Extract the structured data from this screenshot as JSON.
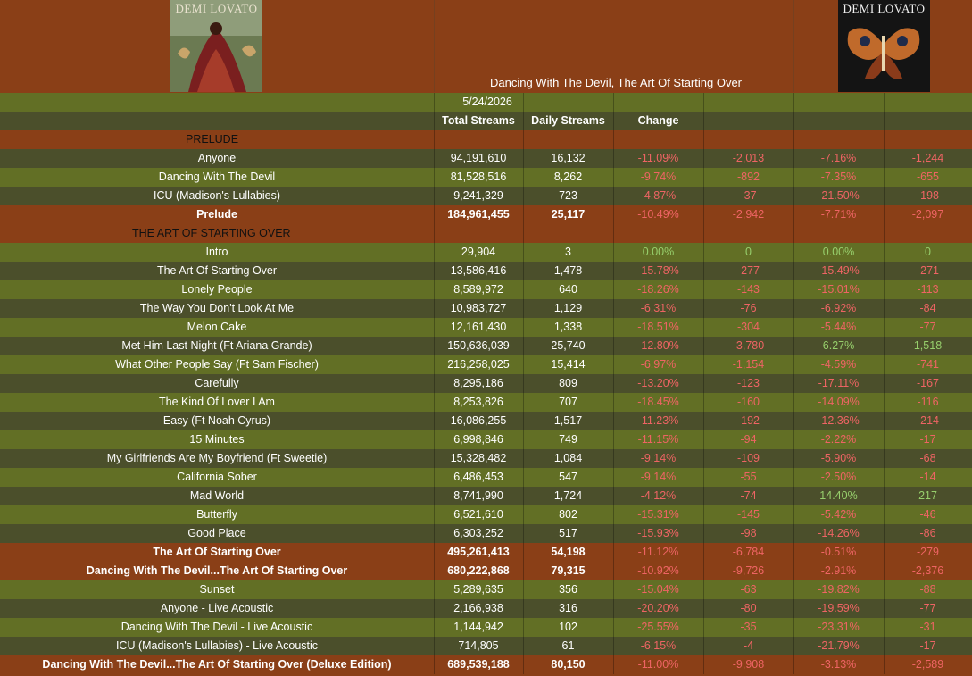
{
  "header": {
    "title": "Dancing With The Devil, The Art Of Starting Over",
    "cover_left_text": "DEMI LOVATO",
    "cover_right_text": "DEMI LOVATO"
  },
  "date": "5/24/2026",
  "columns": {
    "total": "Total Streams",
    "daily": "Daily Streams",
    "change": "Change"
  },
  "colors": {
    "brown": "#8a3f17",
    "olive": "#626f25",
    "dark_olive": "#4b4f2b",
    "negative": "#ee6464",
    "positive": "#97cf6c"
  },
  "sections": [
    {
      "label": "PRELUDE",
      "rows": [
        {
          "name": "Anyone",
          "total": "94,191,610",
          "daily": "16,132",
          "chg": "-11.09%",
          "d1": "-2,013",
          "p2": "-7.16%",
          "d2": "-1,244"
        },
        {
          "name": "Dancing With The Devil",
          "total": "81,528,516",
          "daily": "8,262",
          "chg": "-9.74%",
          "d1": "-892",
          "p2": "-7.35%",
          "d2": "-655"
        },
        {
          "name": "ICU (Madison's Lullabies)",
          "total": "9,241,329",
          "daily": "723",
          "chg": "-4.87%",
          "d1": "-37",
          "p2": "-21.50%",
          "d2": "-198"
        }
      ],
      "totals": [
        {
          "name": "Prelude",
          "total": "184,961,455",
          "daily": "25,117",
          "chg": "-10.49%",
          "d1": "-2,942",
          "p2": "-7.71%",
          "d2": "-2,097"
        }
      ]
    },
    {
      "label": "THE ART OF STARTING OVER",
      "rows": [
        {
          "name": "Intro",
          "total": "29,904",
          "daily": "3",
          "chg": "0.00%",
          "d1": "0",
          "p2": "0.00%",
          "d2": "0"
        },
        {
          "name": "The Art Of Starting Over",
          "total": "13,586,416",
          "daily": "1,478",
          "chg": "-15.78%",
          "d1": "-277",
          "p2": "-15.49%",
          "d2": "-271"
        },
        {
          "name": "Lonely People",
          "total": "8,589,972",
          "daily": "640",
          "chg": "-18.26%",
          "d1": "-143",
          "p2": "-15.01%",
          "d2": "-113"
        },
        {
          "name": "The Way You Don't Look At Me",
          "total": "10,983,727",
          "daily": "1,129",
          "chg": "-6.31%",
          "d1": "-76",
          "p2": "-6.92%",
          "d2": "-84"
        },
        {
          "name": "Melon Cake",
          "total": "12,161,430",
          "daily": "1,338",
          "chg": "-18.51%",
          "d1": "-304",
          "p2": "-5.44%",
          "d2": "-77"
        },
        {
          "name": "Met Him Last Night (Ft Ariana Grande)",
          "total": "150,636,039",
          "daily": "25,740",
          "chg": "-12.80%",
          "d1": "-3,780",
          "p2": "6.27%",
          "d2": "1,518"
        },
        {
          "name": "What Other People Say (Ft Sam Fischer)",
          "total": "216,258,025",
          "daily": "15,414",
          "chg": "-6.97%",
          "d1": "-1,154",
          "p2": "-4.59%",
          "d2": "-741"
        },
        {
          "name": "Carefully",
          "total": "8,295,186",
          "daily": "809",
          "chg": "-13.20%",
          "d1": "-123",
          "p2": "-17.11%",
          "d2": "-167"
        },
        {
          "name": "The Kind Of Lover I Am",
          "total": "8,253,826",
          "daily": "707",
          "chg": "-18.45%",
          "d1": "-160",
          "p2": "-14.09%",
          "d2": "-116"
        },
        {
          "name": "Easy (Ft Noah Cyrus)",
          "total": "16,086,255",
          "daily": "1,517",
          "chg": "-11.23%",
          "d1": "-192",
          "p2": "-12.36%",
          "d2": "-214"
        },
        {
          "name": "15 Minutes",
          "total": "6,998,846",
          "daily": "749",
          "chg": "-11.15%",
          "d1": "-94",
          "p2": "-2.22%",
          "d2": "-17"
        },
        {
          "name": "My Girlfriends Are My Boyfriend (Ft Sweetie)",
          "total": "15,328,482",
          "daily": "1,084",
          "chg": "-9.14%",
          "d1": "-109",
          "p2": "-5.90%",
          "d2": "-68"
        },
        {
          "name": "California Sober",
          "total": "6,486,453",
          "daily": "547",
          "chg": "-9.14%",
          "d1": "-55",
          "p2": "-2.50%",
          "d2": "-14"
        },
        {
          "name": "Mad World",
          "total": "8,741,990",
          "daily": "1,724",
          "chg": "-4.12%",
          "d1": "-74",
          "p2": "14.40%",
          "d2": "217"
        },
        {
          "name": "Butterfly",
          "total": "6,521,610",
          "daily": "802",
          "chg": "-15.31%",
          "d1": "-145",
          "p2": "-5.42%",
          "d2": "-46"
        },
        {
          "name": "Good Place",
          "total": "6,303,252",
          "daily": "517",
          "chg": "-15.93%",
          "d1": "-98",
          "p2": "-14.26%",
          "d2": "-86"
        }
      ],
      "totals": [
        {
          "name": "The Art Of Starting Over",
          "total": "495,261,413",
          "daily": "54,198",
          "chg": "-11.12%",
          "d1": "-6,784",
          "p2": "-0.51%",
          "d2": "-279"
        },
        {
          "name": "Dancing With The Devil...The Art Of Starting Over",
          "total": "680,222,868",
          "daily": "79,315",
          "chg": "-10.92%",
          "d1": "-9,726",
          "p2": "-2.91%",
          "d2": "-2,376"
        }
      ]
    },
    {
      "label": "",
      "rows": [
        {
          "name": "Sunset",
          "total": "5,289,635",
          "daily": "356",
          "chg": "-15.04%",
          "d1": "-63",
          "p2": "-19.82%",
          "d2": "-88"
        },
        {
          "name": "Anyone - Live Acoustic",
          "total": "2,166,938",
          "daily": "316",
          "chg": "-20.20%",
          "d1": "-80",
          "p2": "-19.59%",
          "d2": "-77"
        },
        {
          "name": "Dancing With The Devil - Live Acoustic",
          "total": "1,144,942",
          "daily": "102",
          "chg": "-25.55%",
          "d1": "-35",
          "p2": "-23.31%",
          "d2": "-31"
        },
        {
          "name": "ICU (Madison's Lullabies) - Live Acoustic",
          "total": "714,805",
          "daily": "61",
          "chg": "-6.15%",
          "d1": "-4",
          "p2": "-21.79%",
          "d2": "-17"
        }
      ],
      "totals": [
        {
          "name": "Dancing With The Devil...The Art Of Starting Over (Deluxe Edition)",
          "total": "689,539,188",
          "daily": "80,150",
          "chg": "-11.00%",
          "d1": "-9,908",
          "p2": "-3.13%",
          "d2": "-2,589"
        }
      ]
    }
  ]
}
